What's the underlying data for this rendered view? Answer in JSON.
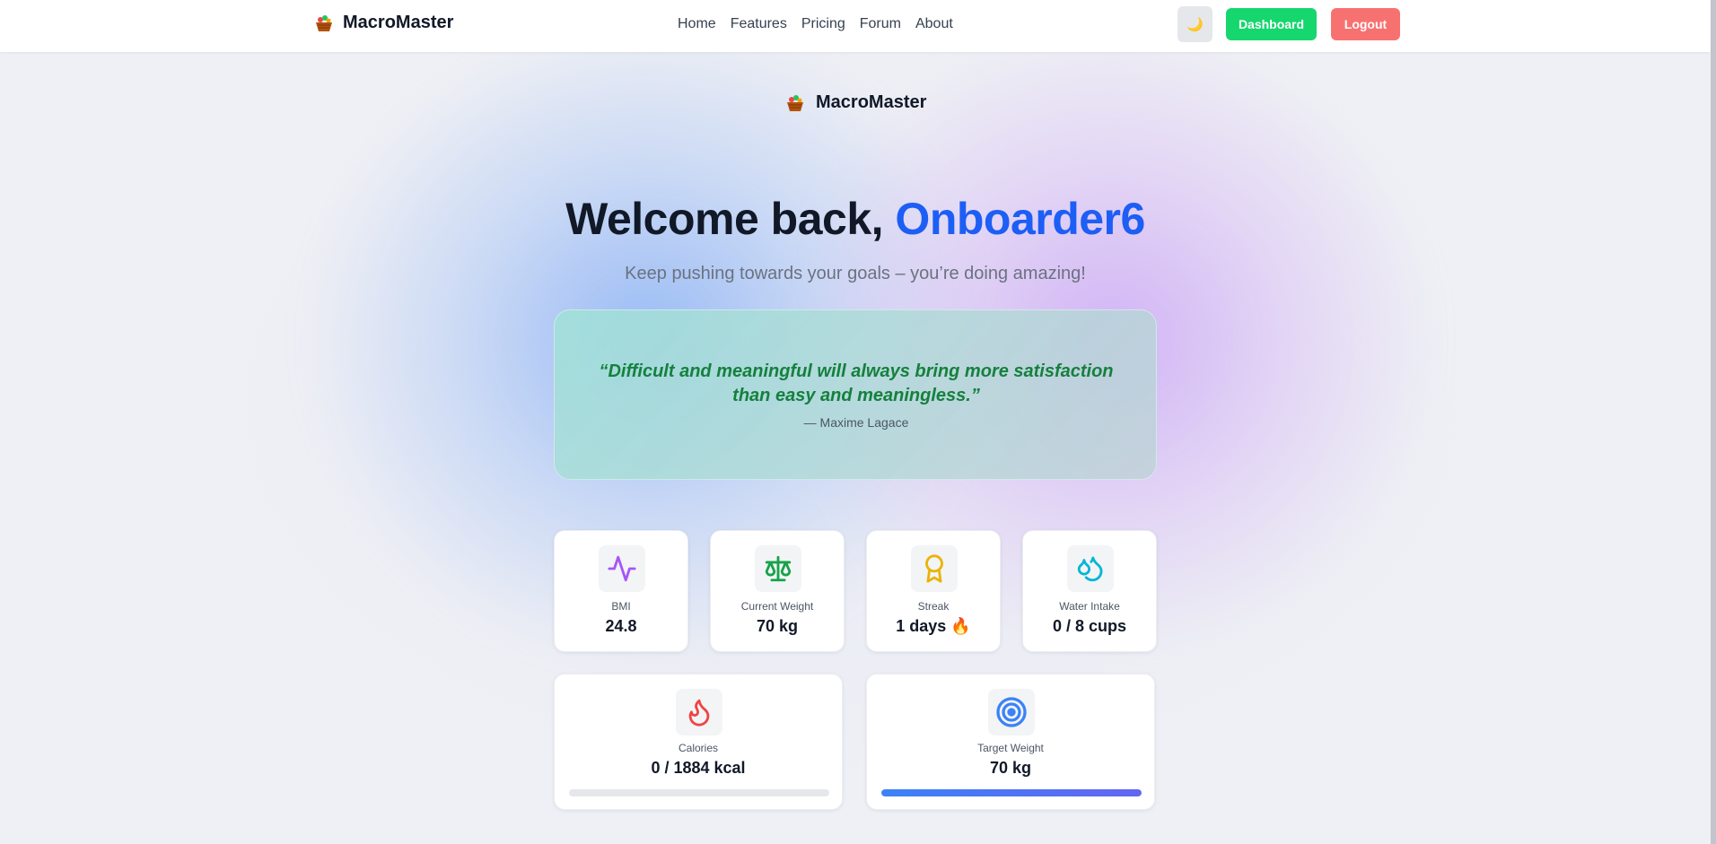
{
  "navbar": {
    "brand": "MacroMaster",
    "links": [
      "Home",
      "Features",
      "Pricing",
      "Forum",
      "About"
    ],
    "theme_toggle_icon": "moon-icon",
    "dashboard_label": "Dashboard",
    "logout_label": "Logout"
  },
  "hero": {
    "brand": "MacroMaster",
    "welcome_prefix": "Welcome back, ",
    "username": "Onboarder6",
    "subtitle": "Keep pushing towards your goals – you’re doing amazing!"
  },
  "quote": {
    "text": "“Difficult and meaningful will always bring more satisfaction than easy and meaningless.”",
    "author": "— Maxime Lagace"
  },
  "stats": [
    {
      "label": "BMI",
      "value": "24.8",
      "icon": "activity-icon",
      "color": "#a855f7"
    },
    {
      "label": "Current Weight",
      "value": "70 kg",
      "icon": "scale-icon",
      "color": "#16a34a"
    },
    {
      "label": "Streak",
      "value": "1 days 🔥",
      "icon": "award-icon",
      "color": "#eab308"
    },
    {
      "label": "Water Intake",
      "value": "0 / 8 cups",
      "icon": "droplets-icon",
      "color": "#06b6d4"
    }
  ],
  "goals": [
    {
      "label": "Calories",
      "value": "0 / 1884 kcal",
      "icon": "flame-icon",
      "color": "#ef4444",
      "progress": 0
    },
    {
      "label": "Target Weight",
      "value": "70 kg",
      "icon": "target-icon",
      "color": "#3b82f6",
      "progress": 1
    }
  ],
  "colors": {
    "accent": "#1d5ef5",
    "dashboard_button": "#16d66e",
    "logout_button": "#f87171",
    "quote_text": "#15803d"
  }
}
